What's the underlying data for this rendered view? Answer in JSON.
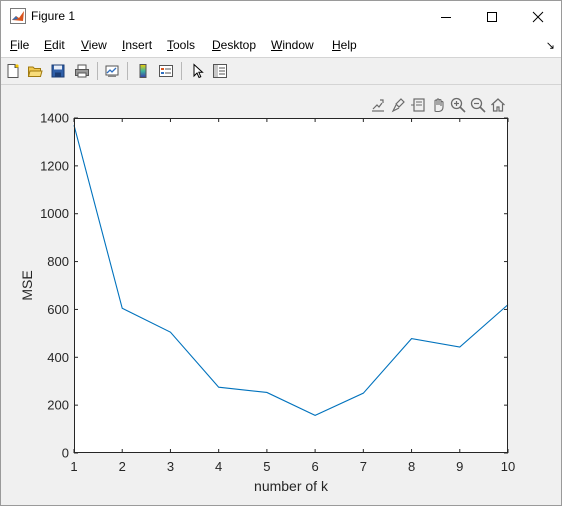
{
  "window": {
    "title": "Figure 1"
  },
  "menu": {
    "items": [
      {
        "accel": "F",
        "rest": "ile"
      },
      {
        "accel": "E",
        "rest": "dit"
      },
      {
        "accel": "V",
        "rest": "iew"
      },
      {
        "accel": "I",
        "rest": "nsert"
      },
      {
        "accel": "T",
        "rest": "ools"
      },
      {
        "accel": "D",
        "rest": "esktop"
      },
      {
        "accel": "W",
        "rest": "indow"
      },
      {
        "accel": "H",
        "rest": "elp"
      }
    ]
  },
  "toolbar": {
    "icons": [
      "new-figure-icon",
      "open-file-icon",
      "save-icon",
      "print-icon",
      "link-plot-icon",
      "colorbar-icon",
      "legend-icon",
      "pointer-icon",
      "property-editor-icon"
    ]
  },
  "axes_toolbar": {
    "icons": [
      "export-icon",
      "brush-icon",
      "data-tips-icon",
      "pan-icon",
      "zoom-in-icon",
      "zoom-out-icon",
      "home-icon"
    ]
  },
  "colors": {
    "line": "#0072bd",
    "axes_bg": "#ffffff",
    "figure_bg": "#f0f0f0"
  },
  "chart_data": {
    "type": "line",
    "x": [
      1,
      2,
      3,
      4,
      5,
      6,
      7,
      8,
      9,
      10
    ],
    "series": [
      {
        "values": [
          1370,
          605,
          505,
          275,
          253,
          157,
          250,
          478,
          443,
          620
        ]
      }
    ],
    "xlabel": "number of k",
    "ylabel": "MSE",
    "xlim": [
      1,
      10
    ],
    "ylim": [
      0,
      1400
    ],
    "xticks": [
      1,
      2,
      3,
      4,
      5,
      6,
      7,
      8,
      9,
      10
    ],
    "yticks": [
      0,
      200,
      400,
      600,
      800,
      1000,
      1200,
      1400
    ],
    "grid": false
  }
}
